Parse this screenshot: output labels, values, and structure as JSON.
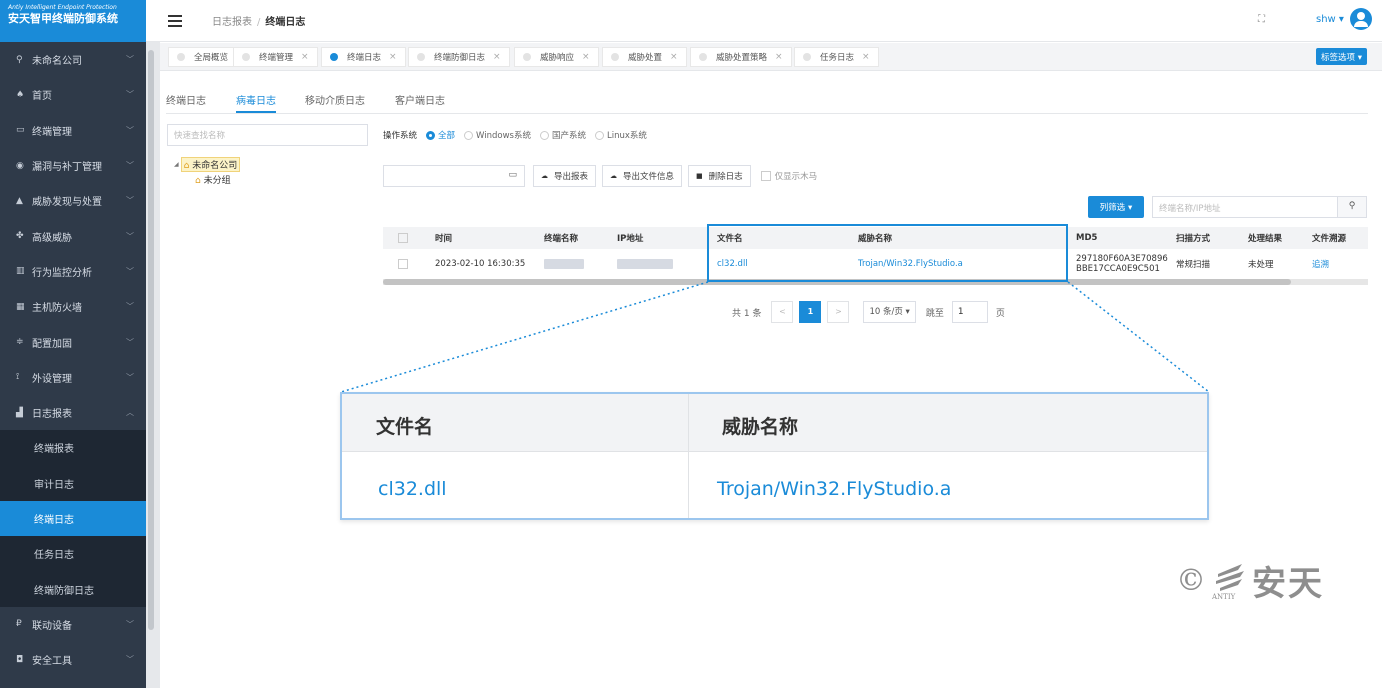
{
  "app": {
    "logo_en": "Antiy Intelligent Endpoint Protection",
    "logo_cn": "安天智甲终端防御系统"
  },
  "sidebar": {
    "company": "未命名公司",
    "items": [
      {
        "label": "首页",
        "icon": "home-icon",
        "glyph": "♠"
      },
      {
        "label": "终端管理",
        "icon": "monitor-icon",
        "glyph": "▭"
      },
      {
        "label": "漏洞与补丁管理",
        "icon": "patch-icon",
        "glyph": "◉"
      },
      {
        "label": "威胁发现与处置",
        "icon": "warning-icon",
        "glyph": "▲"
      },
      {
        "label": "高级威胁",
        "icon": "cluster-icon",
        "glyph": "✤"
      },
      {
        "label": "行为监控分析",
        "icon": "chart-icon",
        "glyph": "▥"
      },
      {
        "label": "主机防火墙",
        "icon": "firewall-icon",
        "glyph": "▦"
      },
      {
        "label": "配置加固",
        "icon": "settings-icon",
        "glyph": "≑"
      },
      {
        "label": "外设管理",
        "icon": "usb-icon",
        "glyph": "⟟"
      },
      {
        "label": "日志报表",
        "icon": "bar-chart-icon",
        "glyph": "▟"
      }
    ],
    "subitems": [
      "终端报表",
      "审计日志",
      "终端日志",
      "任务日志",
      "终端防御日志"
    ],
    "bottom_items": [
      {
        "label": "联动设备",
        "icon": "link-device-icon",
        "glyph": "₽"
      },
      {
        "label": "安全工具",
        "icon": "toolbox-icon",
        "glyph": "◘"
      }
    ]
  },
  "topbar": {
    "breadcrumb_parent": "日志报表",
    "breadcrumb_current": "终端日志",
    "user": "shw ▾"
  },
  "tabs": [
    "全局概览",
    "终端管理",
    "终端日志",
    "终端防御日志",
    "威胁响应",
    "威胁处置",
    "威胁处置策略",
    "任务日志"
  ],
  "tag_options": "标签选项 ▾",
  "subtabs": [
    "终端日志",
    "病毒日志",
    "移动介质日志",
    "客户端日志"
  ],
  "tree": {
    "search_placeholder": "快速查找名称",
    "root": "未命名公司",
    "child": "未分组"
  },
  "filters": {
    "os_label": "操作系统",
    "os_options": [
      "全部",
      "Windows系统",
      "国产系统",
      "Linux系统"
    ],
    "os_selected": "全部",
    "export_report": "导出报表",
    "export_file_info": "导出文件信息",
    "delete_log": "删除日志",
    "only_trojan": "仅显示木马",
    "column_filter": "列筛选 ▾",
    "search_placeholder": "终端名称/IP地址"
  },
  "table": {
    "columns": [
      "时间",
      "终端名称",
      "IP地址",
      "文件名",
      "威胁名称",
      "MD5",
      "扫描方式",
      "处理结果",
      "文件溯源"
    ],
    "rows": [
      {
        "time": "2023-02-10 16:30:35",
        "terminal": "",
        "ip": "",
        "file": "cl32.dll",
        "threat": "Trojan/Win32.FlyStudio.a",
        "md5_line1": "297180F60A3E70896",
        "md5_line2": "BBE17CCA0E9C501",
        "scan": "常规扫描",
        "result": "未处理",
        "trace": "追溯"
      }
    ]
  },
  "pagination": {
    "total": "共 1 条",
    "current_page": "1",
    "page_size": "10 条/页 ▾",
    "jump_label": "跳至",
    "jump_value": "1",
    "page_suffix": "页"
  },
  "zoom": {
    "col1_header": "文件名",
    "col2_header": "威胁名称",
    "col1_value": "cl32.dll",
    "col2_value": "Trojan/Win32.FlyStudio.a"
  },
  "watermark": {
    "symbol": "©",
    "brand": "安天",
    "sub": "ANTIY"
  },
  "colors": {
    "accent": "#1a8bd8",
    "sidebar_bg": "#2f3a49"
  }
}
